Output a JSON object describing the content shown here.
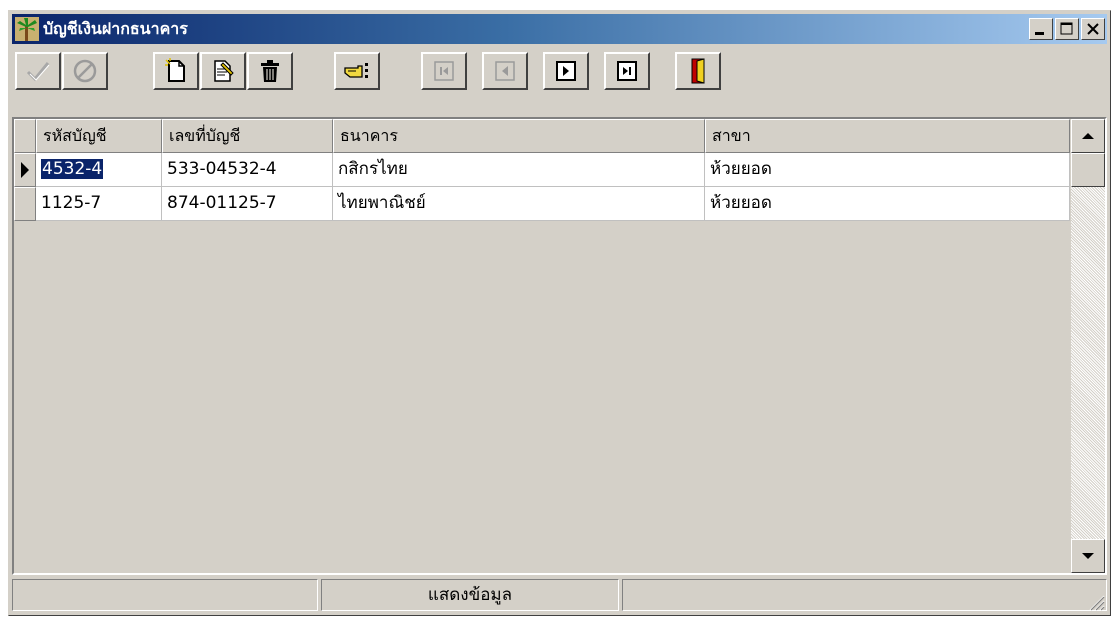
{
  "window": {
    "title": "บัญชีเงินฝากธนาคาร",
    "icon": "palm-tree-icon",
    "caption_buttons": [
      "minimize-icon",
      "maximize-icon",
      "close-icon"
    ]
  },
  "toolbar": {
    "buttons": [
      {
        "icon": "check-icon",
        "enabled": false
      },
      {
        "icon": "cancel-icon",
        "enabled": false
      },
      {
        "icon": "new-document-icon",
        "enabled": true
      },
      {
        "icon": "edit-document-icon",
        "enabled": true
      },
      {
        "icon": "trash-icon",
        "enabled": true
      },
      {
        "icon": "pointing-hand-icon",
        "enabled": true
      },
      {
        "icon": "first-record-icon",
        "enabled": false
      },
      {
        "icon": "prior-record-icon",
        "enabled": false
      },
      {
        "icon": "next-record-icon",
        "enabled": true
      },
      {
        "icon": "last-record-icon",
        "enabled": true
      },
      {
        "icon": "exit-door-icon",
        "enabled": true
      }
    ]
  },
  "grid": {
    "columns": [
      "รหัสบัญชี",
      "เลขที่บัญชี",
      "ธนาคาร",
      "สาขา"
    ],
    "rows": [
      [
        "4532-4",
        "533-04532-4",
        "กสิกรไทย",
        "ห้วยยอด"
      ],
      [
        "1125-7",
        "874-01125-7",
        "ไทยพาณิชย์",
        "ห้วยยอด"
      ]
    ],
    "current_row": 0
  },
  "statusbar": {
    "panels": [
      "",
      "แสดงข้อมูล",
      ""
    ]
  },
  "colors": {
    "title_gradient_start": "#0a246a",
    "title_gradient_end": "#a6caf0",
    "face": "#d4d0c8",
    "selection": "#0a246a"
  }
}
